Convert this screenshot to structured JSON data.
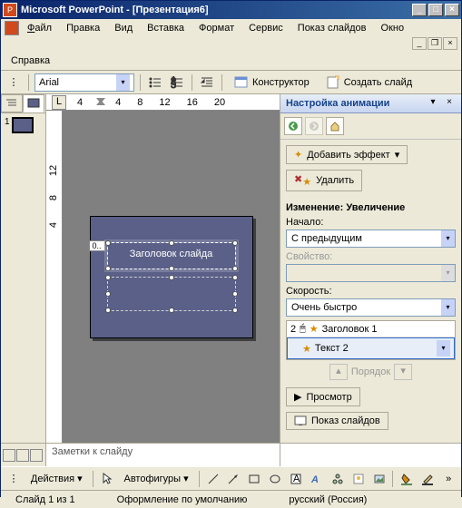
{
  "titlebar": {
    "app": "Microsoft PowerPoint",
    "doc": "[Презентация6]"
  },
  "menu": {
    "file": "Файл",
    "edit": "Правка",
    "view": "Вид",
    "insert": "Вставка",
    "format": "Формат",
    "tools": "Сервис",
    "slideshow": "Показ слайдов",
    "window": "Окно",
    "help": "Справка"
  },
  "toolbar": {
    "font": "Arial",
    "designer": "Конструктор",
    "newslide": "Создать слайд"
  },
  "ruler": {
    "top": [
      "4",
      "4",
      "8",
      "12",
      "16",
      "20"
    ],
    "left": [
      "12",
      "8",
      "4"
    ]
  },
  "outline": {
    "slides": [
      {
        "num": "1"
      }
    ]
  },
  "slide": {
    "title_text": "Заголовок слайда",
    "anim_tag": "0.."
  },
  "taskpane": {
    "title": "Настройка анимации",
    "add_effect": "Добавить эффект",
    "remove": "Удалить",
    "change_label": "Изменение: Увеличение",
    "start_label": "Начало:",
    "start_value": "С предыдущим",
    "property_label": "Свойство:",
    "speed_label": "Скорость:",
    "speed_value": "Очень быстро",
    "items": [
      {
        "num": "2",
        "name": "Заголовок 1"
      },
      {
        "num": "",
        "name": "Текст 2"
      }
    ],
    "order": "Порядок",
    "preview": "Просмотр",
    "slideshow": "Показ слайдов"
  },
  "notes": {
    "placeholder": "Заметки к слайду"
  },
  "drawbar": {
    "actions": "Действия",
    "autoshapes": "Автофигуры"
  },
  "status": {
    "slide": "Слайд 1 из 1",
    "design": "Оформление по умолчанию",
    "lang": "русский (Россия)"
  }
}
